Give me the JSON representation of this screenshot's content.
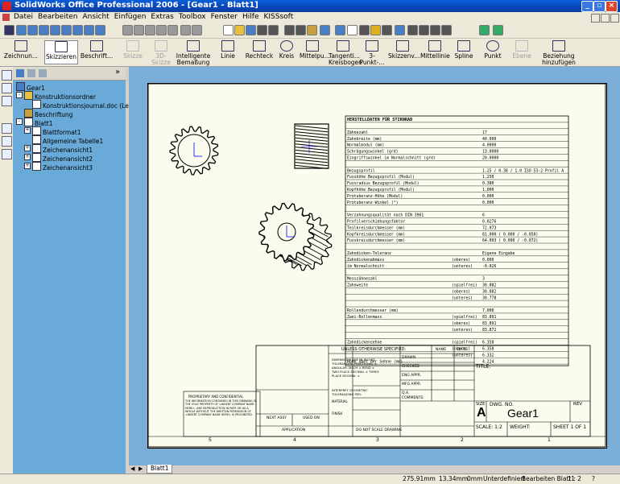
{
  "window": {
    "title": "SolidWorks Office Professional 2006 - [Gear1 - Blatt1]"
  },
  "menu": [
    "Datei",
    "Bearbeiten",
    "Ansicht",
    "Einfügen",
    "Extras",
    "Toolbox",
    "Fenster",
    "Hilfe",
    "KISSsoft"
  ],
  "sketch_toolbar": [
    {
      "label": "Zeichnun...",
      "enabled": true
    },
    {
      "label": "Skizzieren",
      "enabled": true
    },
    {
      "label": "Beschrift...",
      "enabled": true
    },
    {
      "label": "Skizze",
      "enabled": false
    },
    {
      "label": "3D-Skizze",
      "enabled": false
    },
    {
      "label": "Intelligente Bemaßung",
      "enabled": true
    },
    {
      "label": "Linie",
      "enabled": true
    },
    {
      "label": "Rechteck",
      "enabled": true
    },
    {
      "label": "Kreis",
      "enabled": true
    },
    {
      "label": "Mittelpu...",
      "enabled": true
    },
    {
      "label": "Tangenti... Kreisbogen",
      "enabled": true
    },
    {
      "label": "3-Punkt-...",
      "enabled": true
    },
    {
      "label": "Skizzenv...",
      "enabled": true
    },
    {
      "label": "Mittellinie",
      "enabled": true
    },
    {
      "label": "Spline",
      "enabled": true
    },
    {
      "label": "Punkt",
      "enabled": true
    },
    {
      "label": "Ebene",
      "enabled": false
    },
    {
      "label": "Beziehung hinzufügen",
      "enabled": true
    }
  ],
  "tree": [
    {
      "label": "Gear1",
      "level": 0,
      "icon": "drawing-icon"
    },
    {
      "label": "Konstruktionsordner",
      "level": 1,
      "icon": "folder-icon",
      "expand": "-"
    },
    {
      "label": "Konstruktionsjournal.doc (Leer)",
      "level": 2,
      "icon": "document-icon"
    },
    {
      "label": "Beschriftung",
      "level": 1,
      "icon": "annotation-icon"
    },
    {
      "label": "Blatt1",
      "level": 1,
      "icon": "sheet-icon",
      "expand": "-"
    },
    {
      "label": "Blattformat1",
      "level": 2,
      "icon": "sheet-format-icon",
      "expand": "+"
    },
    {
      "label": "Allgemeine Tabelle1",
      "level": 2,
      "icon": "table-icon"
    },
    {
      "label": "Zeichenansicht1",
      "level": 2,
      "icon": "view-icon",
      "expand": "+"
    },
    {
      "label": "Zeichenansicht2",
      "level": 2,
      "icon": "view-icon",
      "expand": "+"
    },
    {
      "label": "Zeichenansicht3",
      "level": 2,
      "icon": "view-icon",
      "expand": "+"
    }
  ],
  "gear_table": [
    [
      "HERSTELLDATEN FÜR STIRNRAD",
      "",
      "",
      ""
    ],
    [
      "",
      "",
      "",
      ""
    ],
    [
      "Zähnezahl",
      "",
      "17",
      ""
    ],
    [
      "Zahnbreite (mm)",
      "",
      "40.000",
      ""
    ],
    [
      "Normalmodul (mm)",
      "",
      "4.0000",
      ""
    ],
    [
      "Schrägungswinkel (grd)",
      "",
      "13.0000",
      ""
    ],
    [
      "Eingriffswinkel im Normalschnitt (grd)",
      "",
      "20.0000",
      ""
    ],
    [
      "",
      "",
      "",
      ""
    ],
    [
      "Bezugsprofil",
      "",
      "1.25 / 0.38 / 1.0 ISO 53:2 Profil A",
      ""
    ],
    [
      "Fusshöhe Bezugsprofil (Modul)",
      "",
      "1.250",
      ""
    ],
    [
      "Fussradius Bezugsprofil (Modul)",
      "",
      "0.380",
      ""
    ],
    [
      "Kopfhöhe Bezugsprofil (Modul)",
      "",
      "1.000",
      ""
    ],
    [
      "Protuberanz-Höhe (Modul)",
      "",
      "0.000",
      ""
    ],
    [
      "Protuberanz-Winkel (°)",
      "",
      "0.000",
      ""
    ],
    [
      "",
      "",
      "",
      ""
    ],
    [
      "Verzahnungsqualität nach DIN 3961",
      "",
      "6",
      ""
    ],
    [
      "Profilverschiebungsfaktor",
      "",
      "0.0276",
      ""
    ],
    [
      "Teilkreisdurchmesser (mm)",
      "",
      "72.073",
      ""
    ],
    [
      "Kopfkreisdurchmesser (mm)",
      "",
      "81.000  ( 0.000 / -0.050)",
      ""
    ],
    [
      "Fusskreisdurchmesser (mm)",
      "",
      "64.093  ( 0.000 / -0.072)",
      ""
    ],
    [
      "",
      "",
      "",
      ""
    ],
    [
      "Zahndicken-Toleranz",
      "",
      "Eigene Eingabe",
      ""
    ],
    [
      "Zahndickenabmass",
      "(oberes)",
      "0.000",
      ""
    ],
    [
      "  im Normalschnitt",
      "(unteres)",
      "-0.026",
      ""
    ],
    [
      "",
      "",
      "",
      ""
    ],
    [
      "Messzähnezahl",
      "",
      "3",
      ""
    ],
    [
      "Zahnweite",
      "(spielfrei)",
      "30.882",
      ""
    ],
    [
      "",
      "(oberes)",
      "30.882",
      ""
    ],
    [
      "",
      "(unteres)",
      "30.778",
      ""
    ],
    [
      "",
      "",
      "",
      ""
    ],
    [
      "Rollendurchmesser (mm)",
      "",
      "7.000",
      ""
    ],
    [
      "Zwei-Rollenmass",
      "(spielfrei)",
      "83.891",
      ""
    ],
    [
      "",
      "(oberes)",
      "83.891",
      ""
    ],
    [
      "",
      "(unteres)",
      "83.872",
      ""
    ],
    [
      "",
      "",
      "",
      ""
    ],
    [
      "Zahndickensehne",
      "(spielfrei)",
      "6.358",
      ""
    ],
    [
      "",
      "(oberes)",
      "6.358",
      ""
    ],
    [
      "",
      "(unteres)",
      "6.332",
      ""
    ],
    [
      "Höhe über der Sehne (mm)",
      "",
      "4.224",
      ""
    ]
  ],
  "title_block": {
    "unless_specified": "UNLESS OTHERWISE SPECIFIED:",
    "name": "NAME",
    "date": "DATE",
    "drawn": "DRAWN",
    "checked": "CHECKED",
    "eng_appr": "ENG APPR.",
    "mfg_appr": "MFG APPR.",
    "qa": "Q.A.",
    "comments": "COMMENTS:",
    "dims": "DIMENSIONS ARE IN INCHES TOLERANCES: FRACTIONAL ± ANGULAR: MACH ± BEND ± TWO PLACE DECIMAL ± THREE PLACE DECIMAL ±",
    "interpret": "INTERPRET GEOMETRIC TOLERANCING PER:",
    "material": "MATERIAL",
    "finish": "FINISH",
    "do_not_scale": "DO NOT SCALE DRAWING",
    "title_label": "TITLE:",
    "size_label": "SIZE",
    "size": "A",
    "dwg_label": "DWG. NO.",
    "dwg_no": "Gear1",
    "rev_label": "REV",
    "scale": "SCALE: 1:2",
    "weight": "WEIGHT:",
    "sheet": "SHEET 1 OF 1",
    "next_assy": "NEXT ASSY",
    "used_on": "USED ON",
    "application": "APPLICATION",
    "proprietary_title": "PROPRIETARY AND CONFIDENTIAL",
    "proprietary_text": "THE INFORMATION CONTAINED IN THIS DRAWING IS THE SOLE PROPERTY OF <INSERT COMPANY NAME HERE>. ANY REPRODUCTION IN PART OR AS A WHOLE WITHOUT THE WRITTEN PERMISSION OF <INSERT COMPANY NAME HERE> IS PROHIBITED.",
    "zones": [
      "5",
      "4",
      "3",
      "2",
      "1"
    ]
  },
  "tabs": [
    "Blatt1"
  ],
  "status": {
    "x": "275.91mm",
    "y": "13.34mm",
    "z": "0mm",
    "state": "Unterdefiniert",
    "edit": "Bearbeiten Blatt1",
    "scale": "1 : 2"
  }
}
